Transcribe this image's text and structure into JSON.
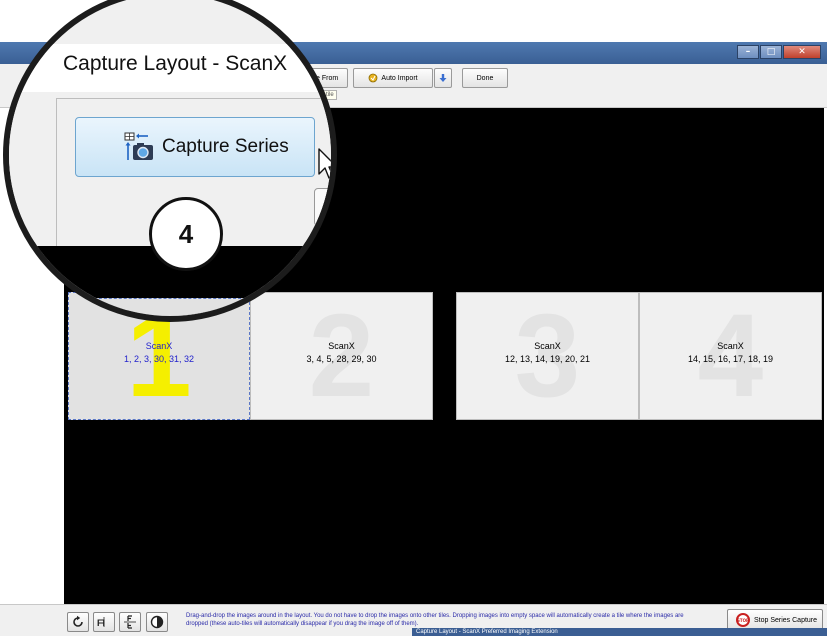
{
  "window": {
    "title": "Capture Layout - ScanX",
    "controls": [
      "minimize",
      "maximize",
      "close"
    ]
  },
  "toolbar": {
    "retake_label": "Retake From",
    "auto_import_label": "Auto Import",
    "done_label": "Done",
    "selected_tile_label": "cted tile",
    "capture_series_label": "Capture Series"
  },
  "callout": {
    "step_number": "4"
  },
  "tiles": [
    {
      "number": "1",
      "name": "ScanX",
      "teeth": "1, 2, 3, 30, 31, 32",
      "selected": true
    },
    {
      "number": "2",
      "name": "ScanX",
      "teeth": "3, 4, 5, 28, 29, 30",
      "selected": false
    },
    {
      "number": "3",
      "name": "ScanX",
      "teeth": "12, 13, 14, 19, 20, 21",
      "selected": false
    },
    {
      "number": "4",
      "name": "ScanX",
      "teeth": "14, 15, 16, 17, 18, 19",
      "selected": false
    }
  ],
  "bottom": {
    "hint_line1": "Drag-and-drop the images around in the layout.  You do not have to drop the images onto other tiles.  Dropping images into empty space will automatically create a tile where the images are",
    "hint_line2": "dropped (these auto-tiles will automatically disappear if you drag the image off of them).",
    "stop_label": "Stop Series Capture",
    "stop_icon_text": "STOP",
    "tools": [
      "rotate-icon",
      "flip-horizontal-icon",
      "flip-vertical-icon",
      "invert-icon"
    ]
  },
  "taskbar": {
    "label": "Capture Layout - ScanX Preferred Imaging Extension"
  },
  "colors": {
    "selected_text": "#2222cc",
    "selected_number": "#f5ef00",
    "canvas": "#000000",
    "stop_red": "#c92020"
  }
}
